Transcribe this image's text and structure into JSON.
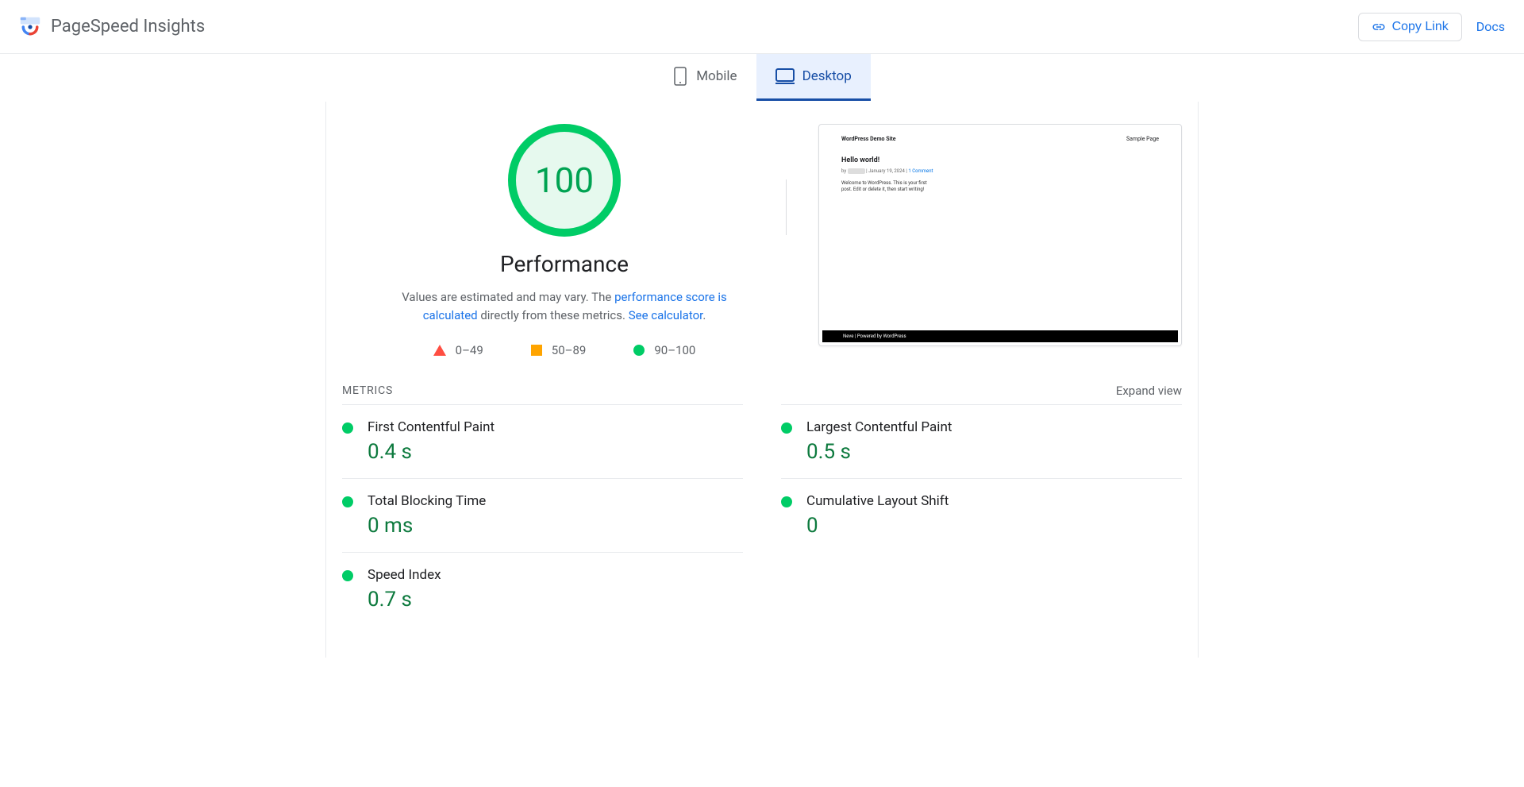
{
  "header": {
    "title": "PageSpeed Insights",
    "copy_link": "Copy Link",
    "docs": "Docs"
  },
  "tabs": {
    "mobile": "Mobile",
    "desktop": "Desktop"
  },
  "performance": {
    "score": "100",
    "title": "Performance",
    "caption_pre": "Values are estimated and may vary. The ",
    "caption_link1": "performance score is calculated",
    "caption_mid": " directly from these metrics. ",
    "caption_link2": "See calculator",
    "caption_dot": "."
  },
  "legend": {
    "range1": "0–49",
    "range2": "50–89",
    "range3": "90–100"
  },
  "preview": {
    "site_title": "WordPress Demo Site",
    "nav": "Sample Page",
    "post_title": "Hello world!",
    "meta_by": "by",
    "meta_sep": " | ",
    "meta_date": "January 19, 2024",
    "meta_comments": "1 Comment",
    "body": "Welcome to WordPress. This is your first post. Edit or delete it, then start writing!",
    "footer": "Neve | Powered by WordPress"
  },
  "metrics_header": {
    "title": "METRICS",
    "expand": "Expand view"
  },
  "metrics": {
    "fcp_name": "First Contentful Paint",
    "fcp_value": "0.4 s",
    "lcp_name": "Largest Contentful Paint",
    "lcp_value": "0.5 s",
    "tbt_name": "Total Blocking Time",
    "tbt_value": "0 ms",
    "cls_name": "Cumulative Layout Shift",
    "cls_value": "0",
    "si_name": "Speed Index",
    "si_value": "0.7 s"
  }
}
